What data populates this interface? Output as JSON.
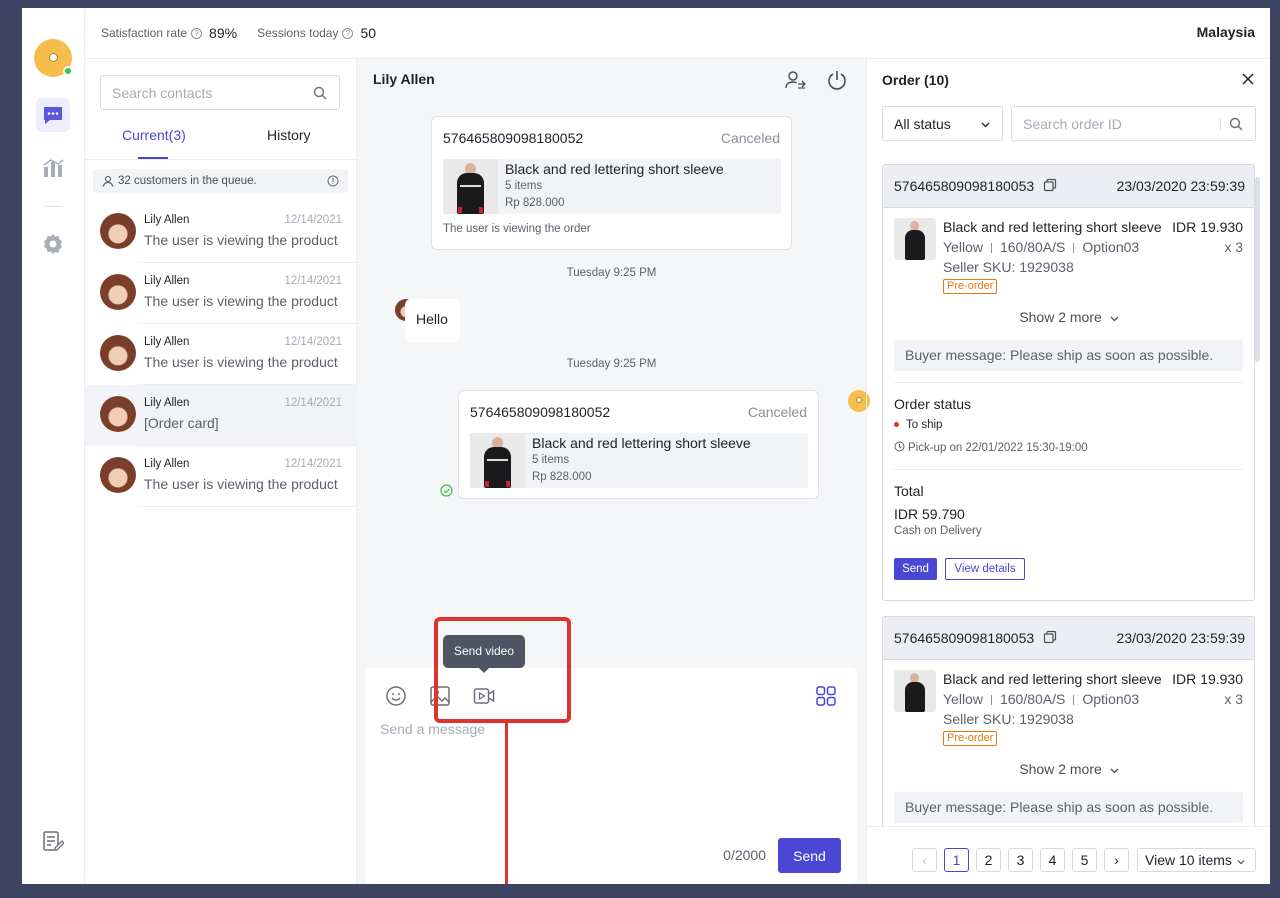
{
  "topbar": {
    "stats": [
      {
        "label": "Satisfaction rate",
        "value": "89%"
      },
      {
        "label": "Sessions today",
        "value": "50"
      }
    ],
    "region": "Malaysia"
  },
  "rail": {
    "icons": [
      "chat-icon",
      "analytics-icon",
      "settings-icon",
      "notes-icon"
    ]
  },
  "contacts": {
    "search_placeholder": "Search contacts",
    "tabs": [
      {
        "label": "Current(3)",
        "active": true
      },
      {
        "label": "History",
        "active": false
      }
    ],
    "queue_text": "32 customers in the queue.",
    "items": [
      {
        "name": "Lily Allen",
        "date": "12/14/2021",
        "preview": "The user is viewing the product"
      },
      {
        "name": "Lily Allen",
        "date": "12/14/2021",
        "preview": "The user is viewing the product"
      },
      {
        "name": "Lily Allen",
        "date": "12/14/2021",
        "preview": "The user is viewing the product"
      },
      {
        "name": "Lily Allen",
        "date": "12/14/2021",
        "preview": "[Order card]"
      },
      {
        "name": "Lily Allen",
        "date": "12/14/2021",
        "preview": "The user is viewing the product"
      }
    ]
  },
  "chat": {
    "title": "Lily Allen",
    "card1": {
      "order_id": "576465809098180052",
      "status": "Canceled",
      "product_name": "Black and red lettering short sleeve",
      "items": "5 items",
      "price": "Rp 828.000",
      "note": "The user is viewing the order"
    },
    "timestamp1": "Tuesday  9:25 PM",
    "hello": "Hello",
    "timestamp2": "Tuesday  9:25 PM",
    "card2": {
      "order_id": "576465809098180052",
      "status": "Canceled",
      "product_name": "Black and red lettering short sleeve",
      "items": "5 items",
      "price": "Rp 828.000"
    },
    "composer": {
      "tooltip": "Send video",
      "placeholder": "Send a message",
      "count": "0/2000",
      "send_label": "Send"
    }
  },
  "orders": {
    "title": "Order (10)",
    "status_filter": "All status",
    "search_placeholder": "Search order ID",
    "cards": [
      {
        "order_id": "576465809098180053",
        "date": "23/03/2020 23:59:39",
        "product_name": "Black and red lettering short sleeve",
        "price": "IDR 19.930",
        "qty": "x 3",
        "variant": [
          "Yellow",
          "160/80A/S",
          "Option03"
        ],
        "sku": "Seller SKU: 1929038",
        "tag": "Pre-order",
        "show_more": "Show 2 more",
        "buyer_message": "Buyer message: Please ship as soon as possible.",
        "status_title": "Order status",
        "status_value": "To ship",
        "pickup": "Pick-up on 22/01/2022 15:30-19:00",
        "total_title": "Total",
        "total_amount": "IDR 59.790",
        "payment": "Cash on Delivery",
        "send_label": "Send",
        "details_label": "View details"
      },
      {
        "order_id": "576465809098180053",
        "date": "23/03/2020 23:59:39",
        "product_name": "Black and red lettering short sleeve",
        "price": "IDR 19.930",
        "qty": "x 3",
        "variant": [
          "Yellow",
          "160/80A/S",
          "Option03"
        ],
        "sku": "Seller SKU: 1929038",
        "tag": "Pre-order",
        "show_more": "Show 2 more",
        "buyer_message": "Buyer message: Please ship as soon as possible."
      }
    ],
    "pagination": {
      "prev": "‹",
      "pages": [
        "1",
        "2",
        "3",
        "4",
        "5"
      ],
      "current": "1",
      "next": "›",
      "page_size": "View 10 items"
    }
  }
}
